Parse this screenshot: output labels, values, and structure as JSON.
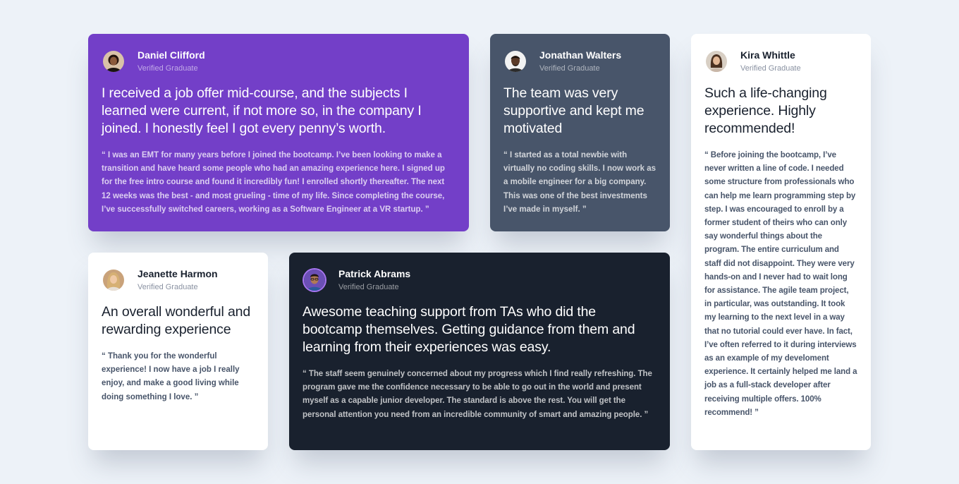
{
  "testimonials": [
    {
      "name": "Daniel Clifford",
      "status": "Verified Graduate",
      "headline": "I received a job offer mid-course, and the subjects I learned were current, if not more so, in the company I joined. I honestly feel I got every penny’s worth.",
      "quote": "“ I was an EMT for many years before I joined the bootcamp. I’ve been looking to make a transition and have heard some people who had an amazing experience here. I signed up for the free intro course and found it incredibly fun! I enrolled shortly thereafter. The next 12 weeks was the best - and most grueling - time of my life. Since completing the course, I’ve successfully switched careers, working as a Software Engineer at a VR startup. ”",
      "avatar_icon": "avatar-daniel-icon",
      "card_color": "#733fc8"
    },
    {
      "name": "Jonathan Walters",
      "status": "Verified Graduate",
      "headline": "The team was very supportive and kept me motivated",
      "quote": "“ I started as a total newbie with virtually no coding skills. I now work as a mobile engineer for a big company. This was one of the best investments I’ve made in myself. ”",
      "avatar_icon": "avatar-jonathan-icon",
      "card_color": "#48556a"
    },
    {
      "name": "Jeanette Harmon",
      "status": "Verified Graduate",
      "headline": "An overall wonderful and rewarding experience",
      "quote": "“ Thank you for the wonderful experience! I now have a job I really enjoy, and make a good living while doing something I love. ”",
      "avatar_icon": "avatar-jeanette-icon",
      "card_color": "#ffffff"
    },
    {
      "name": "Patrick Abrams",
      "status": "Verified Graduate",
      "headline": "Awesome teaching support from TAs who did the bootcamp themselves. Getting guidance from them and learning from their experiences was easy.",
      "quote": "“ The staff seem genuinely concerned about my progress which I find really refreshing. The program gave me the confidence necessary to be able to go out in the world and present myself as a capable junior developer. The standard is above the rest. You will get the personal attention you need from an incredible community of smart and amazing people. ”",
      "avatar_icon": "avatar-patrick-icon",
      "card_color": "#19212e"
    },
    {
      "name": "Kira Whittle",
      "status": "Verified Graduate",
      "headline": "Such a life-changing experience. Highly recommended!",
      "quote": "“ Before joining the bootcamp, I’ve never written a line of code. I needed some structure from professionals who can help me learn programming step by step. I was encouraged to enroll by a former student of theirs who can only say wonderful things about the program. The entire curriculum and staff did not disappoint. They were very hands-on and I never had to wait long for assistance. The agile team project, in particular, was outstanding. It took my learning to the next level in a way that no tutorial could ever have. In fact, I’ve often referred to it during interviews as an example of my develoment experience. It certainly helped me land a job as a full-stack developer after receiving multiple offers. 100% recommend! ”",
      "avatar_icon": "avatar-kira-icon",
      "card_color": "#ffffff"
    }
  ],
  "colors": {
    "page_background": "#edf2f8",
    "purple": "#733fc8",
    "grey_blue": "#48556a",
    "dark_blue": "#19212e",
    "white": "#ffffff",
    "light_purple": "#a775f1"
  }
}
